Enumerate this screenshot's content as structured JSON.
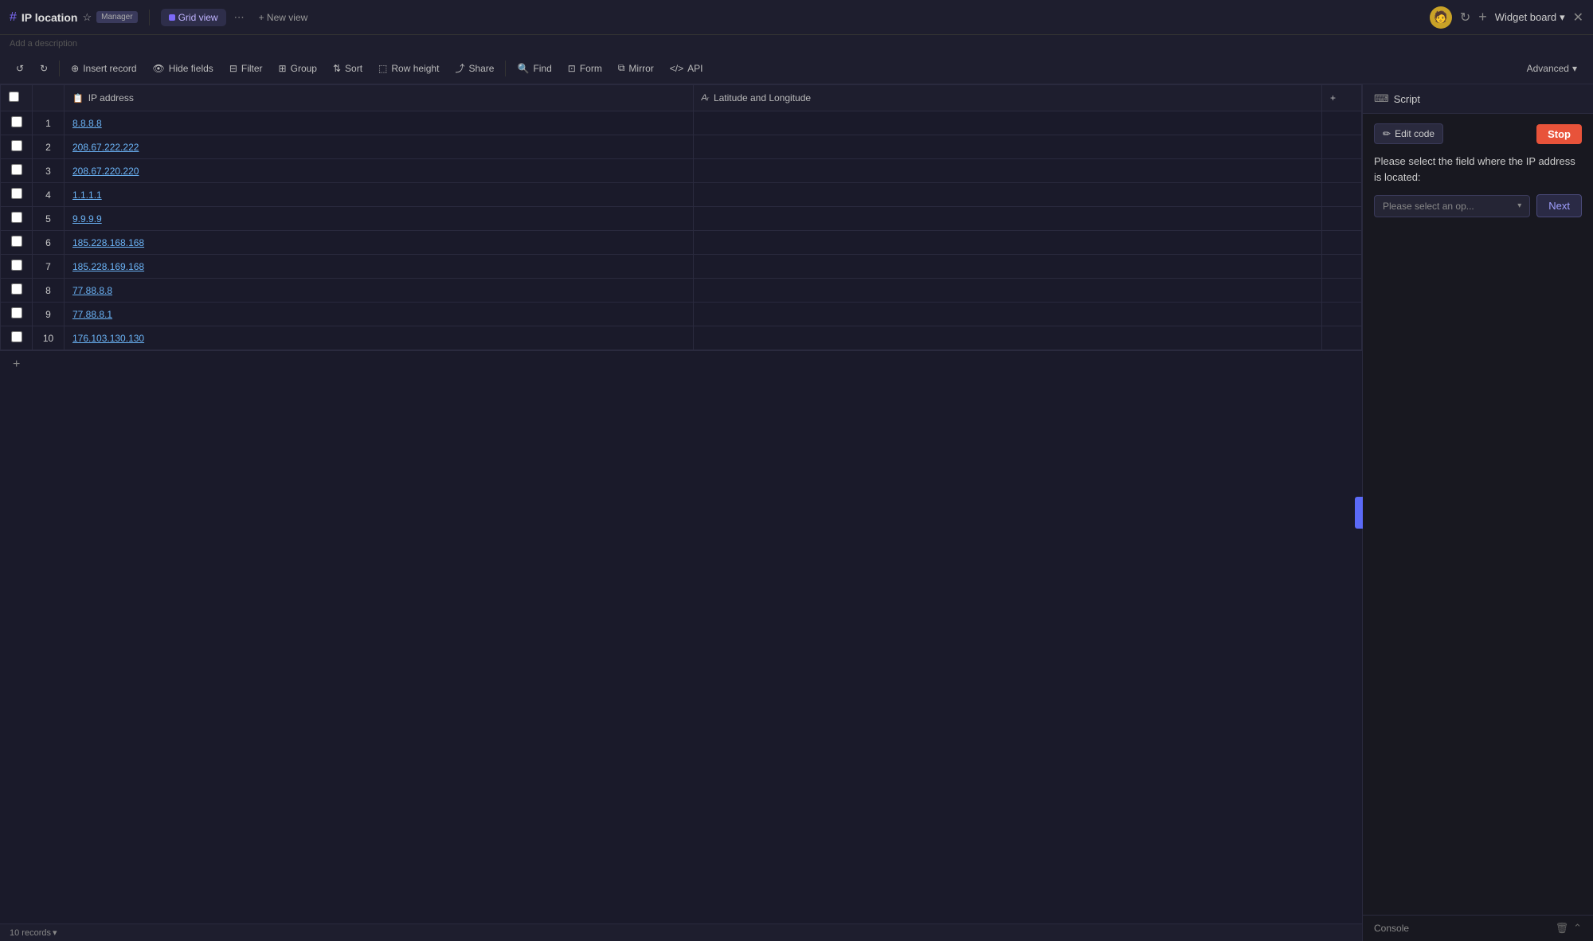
{
  "topbar": {
    "page_title": "IP location",
    "star": "☆",
    "manager_label": "Manager",
    "view_label": "Grid view",
    "new_view_label": "+ New view",
    "widget_board_label": "Widget board",
    "chevron_down": "▾",
    "close": "✕"
  },
  "description": {
    "placeholder": "Add a description"
  },
  "toolbar": {
    "undo": "↺",
    "redo": "↻",
    "insert_record": "Insert record",
    "hide_fields": "Hide fields",
    "filter": "Filter",
    "group": "Group",
    "sort": "Sort",
    "row_height": "Row height",
    "share": "Share",
    "find": "Find",
    "form": "Form",
    "mirror": "Mirror",
    "api": "API",
    "advanced": "Advanced",
    "chevron": "▾"
  },
  "table": {
    "columns": [
      {
        "id": "checkbox",
        "label": ""
      },
      {
        "id": "row_num",
        "label": ""
      },
      {
        "id": "ip_address",
        "label": "IP address",
        "icon": "📋"
      },
      {
        "id": "lat_long",
        "label": "Latitude and Longitude",
        "icon": "Aᵣ"
      },
      {
        "id": "add",
        "label": "+"
      }
    ],
    "rows": [
      {
        "num": "1",
        "ip": "8.8.8.8"
      },
      {
        "num": "2",
        "ip": "208.67.222.222"
      },
      {
        "num": "3",
        "ip": "208.67.220.220"
      },
      {
        "num": "4",
        "ip": "1.1.1.1"
      },
      {
        "num": "5",
        "ip": "9.9.9.9"
      },
      {
        "num": "6",
        "ip": "185.228.168.168"
      },
      {
        "num": "7",
        "ip": "185.228.169.168"
      },
      {
        "num": "8",
        "ip": "77.88.8.8"
      },
      {
        "num": "9",
        "ip": "77.88.8.1"
      },
      {
        "num": "10",
        "ip": "176.103.130.130"
      }
    ]
  },
  "status_bar": {
    "records": "10 records",
    "icon": "▾"
  },
  "script_panel": {
    "title": "Script",
    "edit_code_label": "Edit code",
    "stop_label": "Stop",
    "message": "Please select the field where the IP address is located:",
    "select_placeholder": "Please select an op...",
    "next_label": "Next",
    "console_label": "Console"
  }
}
